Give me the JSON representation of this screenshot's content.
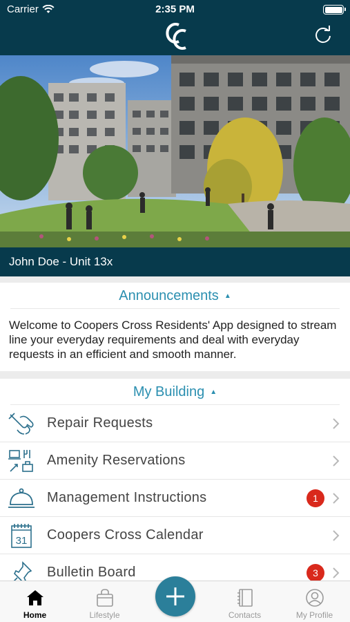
{
  "status_bar": {
    "carrier": "Carrier",
    "time": "2:35 PM"
  },
  "header": {
    "logo_icon": "cc-logo-icon",
    "refresh_icon": "refresh-icon",
    "resident_label": "John Doe - Unit 13x"
  },
  "hero": {
    "image_icon": "building-courtyard-photo"
  },
  "announcements": {
    "title": "Announcements",
    "body": "Welcome to Coopers Cross Residents' App designed to stream line your everyday requirements and deal with everyday requests in an efficient and smooth manner."
  },
  "my_building": {
    "title": "My Building",
    "items": [
      {
        "label": "Repair Requests",
        "icon": "wrench-hand-icon",
        "badge": ""
      },
      {
        "label": "Amenity Reservations",
        "icon": "amenities-icon",
        "badge": ""
      },
      {
        "label": "Management Instructions",
        "icon": "service-bell-icon",
        "badge": "1"
      },
      {
        "label": "Coopers Cross Calendar",
        "icon": "calendar-icon",
        "badge": ""
      },
      {
        "label": "Bulletin Board",
        "icon": "pushpin-icon",
        "badge": "3"
      }
    ]
  },
  "tabbar": {
    "home": "Home",
    "lifestyle": "Lifestyle",
    "contacts": "Contacts",
    "profile": "My Profile",
    "active": "home"
  },
  "colors": {
    "brand_navy": "#073a4c",
    "accent_blue": "#2b8fb0",
    "badge_red": "#d9291c"
  }
}
